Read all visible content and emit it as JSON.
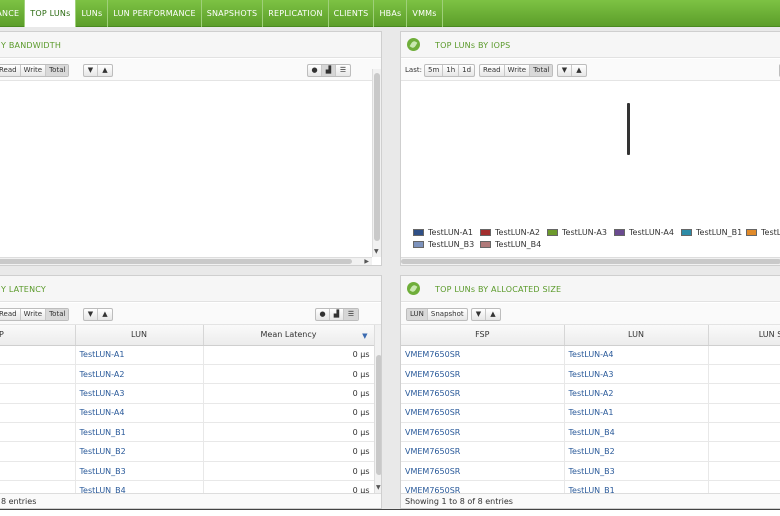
{
  "tabs": [
    {
      "label": "ORMANCE",
      "active": false
    },
    {
      "label": "TOP LUNs",
      "active": true
    },
    {
      "label": "LUNs",
      "active": false
    },
    {
      "label": "LUN PERFORMANCE",
      "active": false
    },
    {
      "label": "SNAPSHOTS",
      "active": false
    },
    {
      "label": "REPLICATION",
      "active": false
    },
    {
      "label": "CLIENTS",
      "active": false
    },
    {
      "label": "HBAs",
      "active": false
    },
    {
      "label": "VMMs",
      "active": false
    }
  ],
  "panel_bandwidth": {
    "title": "Y BANDWIDTH",
    "buttons": [
      "Read",
      "Write",
      "Total"
    ]
  },
  "panel_iops": {
    "title": "TOP LUNs BY IOPS",
    "last_label": "Last:",
    "range_buttons": [
      "5m",
      "1h",
      "1d"
    ],
    "buttons": [
      "Read",
      "Write",
      "Total"
    ],
    "legend": [
      {
        "name": "TestLUN-A1",
        "color": "#2f4f86"
      },
      {
        "name": "TestLUN-A2",
        "color": "#a32e2e"
      },
      {
        "name": "TestLUN-A3",
        "color": "#6d9a2c"
      },
      {
        "name": "TestLUN-A4",
        "color": "#6a4a8f"
      },
      {
        "name": "TestLUN_B1",
        "color": "#2d8ba6"
      },
      {
        "name": "TestL",
        "color": "#e08a2a"
      },
      {
        "name": "TestLUN_B3",
        "color": "#7d93bd"
      },
      {
        "name": "TestLUN_B4",
        "color": "#b07a7a"
      }
    ]
  },
  "panel_latency": {
    "title": "Y LATENCY",
    "buttons": [
      "Read",
      "Write",
      "Total"
    ],
    "columns": [
      "P",
      "LUN",
      "Mean Latency"
    ],
    "rows": [
      {
        "lun": "TestLUN-A1",
        "latency": "0 µs"
      },
      {
        "lun": "TestLUN-A2",
        "latency": "0 µs"
      },
      {
        "lun": "TestLUN-A3",
        "latency": "0 µs"
      },
      {
        "lun": "TestLUN-A4",
        "latency": "0 µs"
      },
      {
        "lun": "TestLUN_B1",
        "latency": "0 µs"
      },
      {
        "lun": "TestLUN_B2",
        "latency": "0 µs"
      },
      {
        "lun": "TestLUN_B3",
        "latency": "0 µs"
      },
      {
        "lun": "TestLUN_B4",
        "latency": "0 µs"
      }
    ],
    "footer": "8 entries"
  },
  "panel_allocated": {
    "title": "TOP LUNs BY ALLOCATED SIZE",
    "buttons": [
      "LUN",
      "Snapshot"
    ],
    "columns": [
      "FSP",
      "LUN",
      "LUN Si"
    ],
    "rows": [
      {
        "fsp": "VMEM7650SR",
        "lun": "TestLUN-A4"
      },
      {
        "fsp": "VMEM7650SR",
        "lun": "TestLUN-A3"
      },
      {
        "fsp": "VMEM7650SR",
        "lun": "TestLUN-A2"
      },
      {
        "fsp": "VMEM7650SR",
        "lun": "TestLUN-A1"
      },
      {
        "fsp": "VMEM7650SR",
        "lun": "TestLUN_B4"
      },
      {
        "fsp": "VMEM7650SR",
        "lun": "TestLUN_B2"
      },
      {
        "fsp": "VMEM7650SR",
        "lun": "TestLUN_B3"
      },
      {
        "fsp": "VMEM7650SR",
        "lun": "TestLUN_B1"
      }
    ],
    "footer": "Showing 1 to 8 of 8 entries"
  },
  "icons": {
    "sort_up": "▲",
    "sort_down": "▼",
    "pie": "pie-chart-icon",
    "bar": "bar-chart-icon",
    "list": "list-icon",
    "leaf": "leaf-icon"
  }
}
